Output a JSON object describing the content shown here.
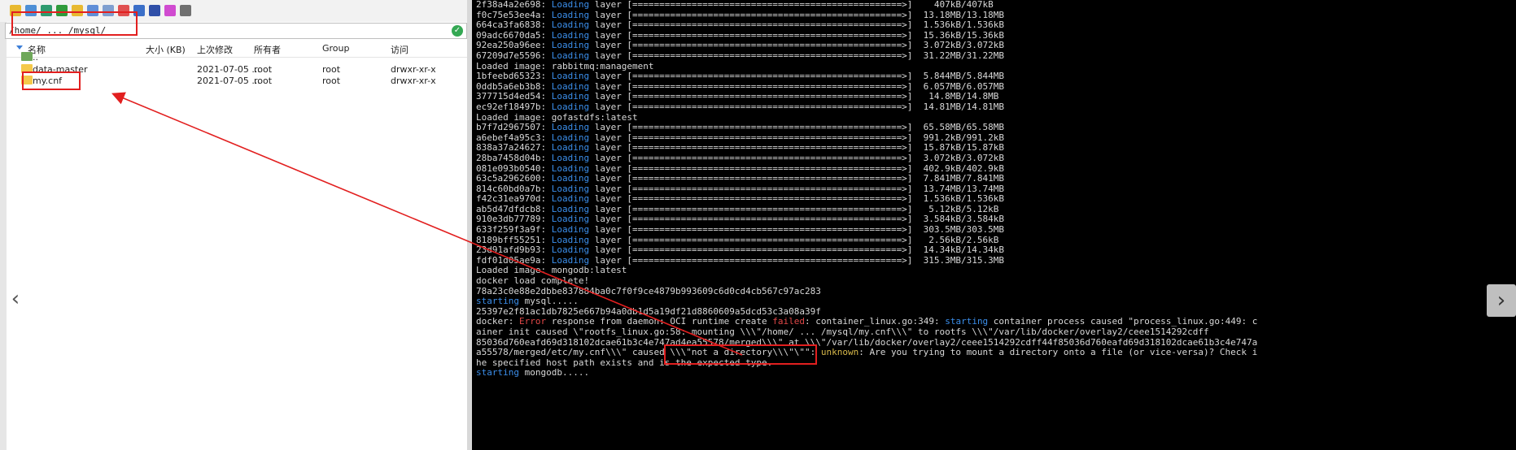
{
  "file_panel": {
    "path": "/home/ ... /mysql/",
    "columns": [
      "名称",
      "大小 (KB)",
      "上次修改",
      "所有者",
      "Group",
      "访问"
    ],
    "rows": [
      {
        "name": "..",
        "size": "",
        "modified": "",
        "owner": "",
        "group": "",
        "access": "",
        "icon": "parent-folder-icon"
      },
      {
        "name": "data-master",
        "size": "",
        "modified": "2021-07-05 ...",
        "owner": "root",
        "group": "root",
        "access": "drwxr-xr-x",
        "icon": "folder-icon"
      },
      {
        "name": "my.cnf",
        "size": "",
        "modified": "2021-07-05 ...",
        "owner": "root",
        "group": "root",
        "access": "drwxr-xr-x",
        "icon": "folder-icon"
      }
    ],
    "toolbar_icons": [
      "folder-open-icon",
      "download-icon",
      "upload-icon",
      "refresh-icon",
      "new-folder-icon",
      "new-file-icon",
      "copy-icon",
      "delete-icon",
      "rename-icon",
      "properties-icon",
      "edit-icon",
      "terminal-icon"
    ]
  },
  "navigation": {
    "prev": "‹",
    "next": "›"
  },
  "terminal": {
    "lines": [
      [
        {
          "t": "2f38a4a2e698: "
        },
        {
          "t": "Loading",
          "c": "blue"
        },
        {
          "t": " layer [==================================================>]    407kB/407kB"
        }
      ],
      [
        {
          "t": "f0c75e53ee4a: "
        },
        {
          "t": "Loading",
          "c": "blue"
        },
        {
          "t": " layer [==================================================>]  13.18MB/13.18MB"
        }
      ],
      [
        {
          "t": "664ca3fa6838: "
        },
        {
          "t": "Loading",
          "c": "blue"
        },
        {
          "t": " layer [==================================================>]  1.536kB/1.536kB"
        }
      ],
      [
        {
          "t": "09adc6670da5: "
        },
        {
          "t": "Loading",
          "c": "blue"
        },
        {
          "t": " layer [==================================================>]  15.36kB/15.36kB"
        }
      ],
      [
        {
          "t": "92ea250a96ee: "
        },
        {
          "t": "Loading",
          "c": "blue"
        },
        {
          "t": " layer [==================================================>]  3.072kB/3.072kB"
        }
      ],
      [
        {
          "t": "67209d7e5596: "
        },
        {
          "t": "Loading",
          "c": "blue"
        },
        {
          "t": " layer [==================================================>]  31.22MB/31.22MB"
        }
      ],
      [
        {
          "t": "Loaded image: rabbitmq:management"
        }
      ],
      [
        {
          "t": "1bfeebd65323: "
        },
        {
          "t": "Loading",
          "c": "blue"
        },
        {
          "t": " layer [==================================================>]  5.844MB/5.844MB"
        }
      ],
      [
        {
          "t": "0ddb5a6eb3b8: "
        },
        {
          "t": "Loading",
          "c": "blue"
        },
        {
          "t": " layer [==================================================>]  6.057MB/6.057MB"
        }
      ],
      [
        {
          "t": "377715d4ed54: "
        },
        {
          "t": "Loading",
          "c": "blue"
        },
        {
          "t": " layer [==================================================>]   14.8MB/14.8MB"
        }
      ],
      [
        {
          "t": "ec92ef18497b: "
        },
        {
          "t": "Loading",
          "c": "blue"
        },
        {
          "t": " layer [==================================================>]  14.81MB/14.81MB"
        }
      ],
      [
        {
          "t": "Loaded image: gofastdfs:latest"
        }
      ],
      [
        {
          "t": "b7f7d2967507: "
        },
        {
          "t": "Loading",
          "c": "blue"
        },
        {
          "t": " layer [==================================================>]  65.58MB/65.58MB"
        }
      ],
      [
        {
          "t": "a6ebef4a95c3: "
        },
        {
          "t": "Loading",
          "c": "blue"
        },
        {
          "t": " layer [==================================================>]  991.2kB/991.2kB"
        }
      ],
      [
        {
          "t": "838a37a24627: "
        },
        {
          "t": "Loading",
          "c": "blue"
        },
        {
          "t": " layer [==================================================>]  15.87kB/15.87kB"
        }
      ],
      [
        {
          "t": "28ba7458d04b: "
        },
        {
          "t": "Loading",
          "c": "blue"
        },
        {
          "t": " layer [==================================================>]  3.072kB/3.072kB"
        }
      ],
      [
        {
          "t": "081e093b0540: "
        },
        {
          "t": "Loading",
          "c": "blue"
        },
        {
          "t": " layer [==================================================>]  402.9kB/402.9kB"
        }
      ],
      [
        {
          "t": "63c5a2962600: "
        },
        {
          "t": "Loading",
          "c": "blue"
        },
        {
          "t": " layer [==================================================>]  7.841MB/7.841MB"
        }
      ],
      [
        {
          "t": "814c60bd0a7b: "
        },
        {
          "t": "Loading",
          "c": "blue"
        },
        {
          "t": " layer [==================================================>]  13.74MB/13.74MB"
        }
      ],
      [
        {
          "t": "f42c31ea970d: "
        },
        {
          "t": "Loading",
          "c": "blue"
        },
        {
          "t": " layer [==================================================>]  1.536kB/1.536kB"
        }
      ],
      [
        {
          "t": "ab5d47dfdcb8: "
        },
        {
          "t": "Loading",
          "c": "blue"
        },
        {
          "t": " layer [==================================================>]   5.12kB/5.12kB"
        }
      ],
      [
        {
          "t": "910e3db77789: "
        },
        {
          "t": "Loading",
          "c": "blue"
        },
        {
          "t": " layer [==================================================>]  3.584kB/3.584kB"
        }
      ],
      [
        {
          "t": "633f259f3a9f: "
        },
        {
          "t": "Loading",
          "c": "blue"
        },
        {
          "t": " layer [==================================================>]  303.5MB/303.5MB"
        }
      ],
      [
        {
          "t": "8189bff55251: "
        },
        {
          "t": "Loading",
          "c": "blue"
        },
        {
          "t": " layer [==================================================>]   2.56kB/2.56kB"
        }
      ],
      [
        {
          "t": "23d91afd9b93: "
        },
        {
          "t": "Loading",
          "c": "blue"
        },
        {
          "t": " layer [==================================================>]  14.34kB/14.34kB"
        }
      ],
      [
        {
          "t": "fdf01d05ae9a: "
        },
        {
          "t": "Loading",
          "c": "blue"
        },
        {
          "t": " layer [==================================================>]  315.3MB/315.3MB"
        }
      ],
      [
        {
          "t": "Loaded image: mongodb:latest"
        }
      ],
      [
        {
          "t": "docker load complete!"
        }
      ],
      [
        {
          "t": "78a23c0e88e2dbbe837884ba0c7f0f9ce4879b993609c6d0cd4cb567c97ac283"
        }
      ],
      [
        {
          "t": "starting",
          "c": "blue"
        },
        {
          "t": " mysql....."
        }
      ],
      [
        {
          "t": "25397e2f81ac1db7825e667b94a0db1d5a19df21d8860609a5dcd53c3a08a39f"
        }
      ],
      [
        {
          "t": "docker: "
        },
        {
          "t": "Error",
          "c": "red"
        },
        {
          "t": " response from daemon: OCI runtime create "
        },
        {
          "t": "failed",
          "c": "red"
        },
        {
          "t": ": container_linux.go:349: "
        },
        {
          "t": "starting",
          "c": "blue"
        },
        {
          "t": " container process caused \"process_linux.go:449: c"
        }
      ],
      [
        {
          "t": "ainer init caused \\\"rootfs_linux.go:58: mounting \\\\\\\"/home/ ... /mysql/my.cnf\\\\\\\" to rootfs \\\\\\\"/var/lib/docker/overlay2/ceee1514292cdff"
        }
      ],
      [
        {
          "t": "85036d760eafd69d318102dcae61b3c4e747ad4ea55578/merged\\\\\\\" at \\\\\\\"/var/lib/docker/overlay2/ceee1514292cdff44f85036d760eafd69d318102dcae61b3c4e747a"
        }
      ],
      [
        {
          "t": "a55578/merged/etc/my.cnf\\\\\\\" caused \\\\\\\"not a directory\\\\\\\"\\\"\": "
        },
        {
          "t": "unknown",
          "c": "yellow"
        },
        {
          "t": ": Are you trying to mount a directory onto a file (or vice-versa)? Check i"
        }
      ],
      [
        {
          "t": "he specified host path exists and is the expected type."
        }
      ],
      [
        {
          "t": "starting",
          "c": "blue"
        },
        {
          "t": " mongodb....."
        }
      ]
    ]
  },
  "colors": {
    "annotation": "#e21f1f",
    "terminal_bg": "#000000",
    "keyword_blue": "#3b8eea",
    "error_red": "#e04848"
  }
}
